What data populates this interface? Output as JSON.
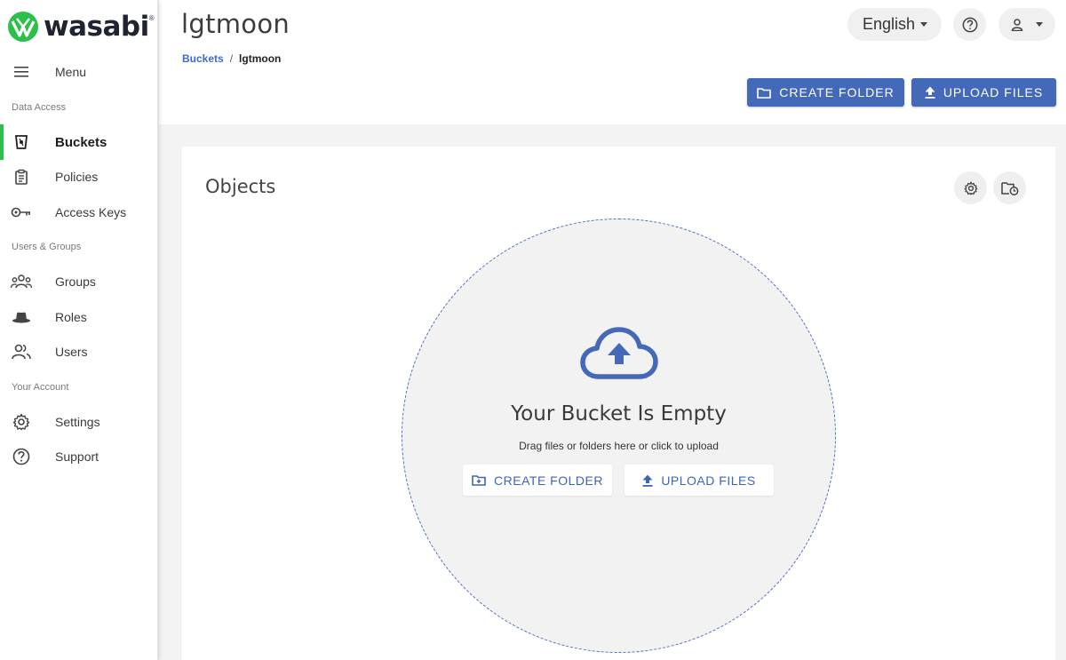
{
  "brand": {
    "name": "wasabi",
    "tm": "®",
    "accent": "#2cc04b"
  },
  "sidebar": {
    "menu_label": "Menu",
    "sections": {
      "data_access": "Data Access",
      "users_groups": "Users & Groups",
      "your_account": "Your Account"
    },
    "items": [
      {
        "label": "Buckets",
        "icon": "bucket-icon",
        "active": true
      },
      {
        "label": "Policies",
        "icon": "clipboard-icon",
        "active": false
      },
      {
        "label": "Access Keys",
        "icon": "key-icon",
        "active": false
      },
      {
        "label": "Groups",
        "icon": "groups-icon",
        "active": false
      },
      {
        "label": "Roles",
        "icon": "hat-icon",
        "active": false
      },
      {
        "label": "Users",
        "icon": "users-icon",
        "active": false
      },
      {
        "label": "Settings",
        "icon": "gear-icon",
        "active": false
      },
      {
        "label": "Support",
        "icon": "help-circle-icon",
        "active": false
      }
    ]
  },
  "header": {
    "title": "lgtmoon",
    "breadcrumb": {
      "root": "Buckets",
      "separator": "/",
      "current": "lgtmoon"
    },
    "language": "English",
    "create_folder_label": "CREATE FOLDER",
    "upload_files_label": "UPLOAD FILES",
    "primary_color": "#4469b8"
  },
  "objects": {
    "title": "Objects",
    "empty_title": "Your Bucket Is Empty",
    "empty_subtitle": "Drag files or folders here or click to upload",
    "create_folder_label": "CREATE FOLDER",
    "upload_files_label": "UPLOAD FILES"
  }
}
